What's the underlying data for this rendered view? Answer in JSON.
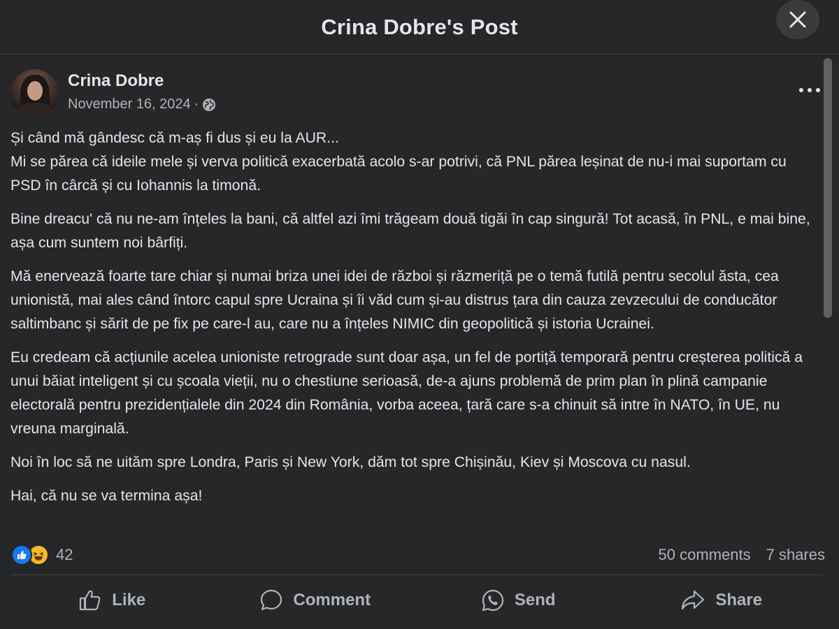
{
  "dialog": {
    "title": "Crina Dobre's Post"
  },
  "post": {
    "author": "Crina Dobre",
    "date": "November 16, 2024",
    "meta_separator": "·",
    "paragraphs": [
      "Și când mă gândesc că m-aș fi dus și eu la AUR...",
      "Mi se părea că ideile mele și verva politică exacerbată acolo s-ar potrivi, că PNL părea leșinat de nu-i mai suportam cu PSD în cârcă și cu Iohannis la timonă.",
      "Bine dreacu' că nu ne-am înțeles la bani, că altfel azi îmi trăgeam două tigăi în cap singură! Tot acasă, în PNL, e mai bine, așa cum suntem noi bârfiți.",
      "Mă enervează foarte tare chiar și numai briza unei idei de război și răzmeriță pe o temă futilă pentru secolul ăsta, cea unionistă, mai ales când întorc capul spre Ucraina și îi văd cum și-au distrus țara din cauza zevzecului de conducător saltimbanc și sărit de pe fix pe care-l au, care nu a înțeles NIMIC din geopolitică și istoria Ucrainei.",
      "Eu credeam că acțiunile acelea unioniste retrograde sunt doar așa, un fel de portiță temporară pentru creșterea politică a unui băiat inteligent și cu școala vieții, nu o chestiune serioasă, de-a ajuns problemă de prim plan în plină campanie electorală pentru prezidențialele din 2024 din România, vorba aceea, țară care s-a chinuit să intre în NATO, în UE, nu vreuna marginală.",
      "Noi în loc să ne uităm spre Londra, Paris și New York, dăm tot spre Chișinău, Kiev și Moscova cu nasul.",
      "Hai, că nu se va termina așa!"
    ],
    "reaction_count": "42",
    "comments": "50 comments",
    "shares": "7 shares"
  },
  "actions": {
    "like": "Like",
    "comment": "Comment",
    "send": "Send",
    "share": "Share"
  },
  "icons": {
    "close": "close-icon",
    "more": "more-icon",
    "privacy": "globe-icon",
    "like_reaction": "like-reaction-icon",
    "haha_reaction": "haha-reaction-icon"
  },
  "colors": {
    "background": "#252728",
    "text_primary": "#e4e6eb",
    "text_secondary": "#b0b3b8",
    "like_blue": "#1877f2",
    "haha_yellow": "#f7b928"
  }
}
